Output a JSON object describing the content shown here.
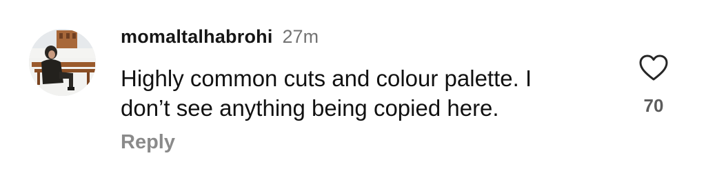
{
  "comment": {
    "username": "momaltalhabrohi",
    "time_ago": "27m",
    "text_lines": [
      "Highly common cuts and colour palette. I",
      "don’t see anything being copied here."
    ],
    "reply_label": "Reply",
    "like_count": "70",
    "like_icon": "heart-outline-icon"
  },
  "colors": {
    "username": "#161616",
    "muted": "#737373",
    "reply": "#8a8a8a",
    "like_count": "#5c5c5c"
  }
}
